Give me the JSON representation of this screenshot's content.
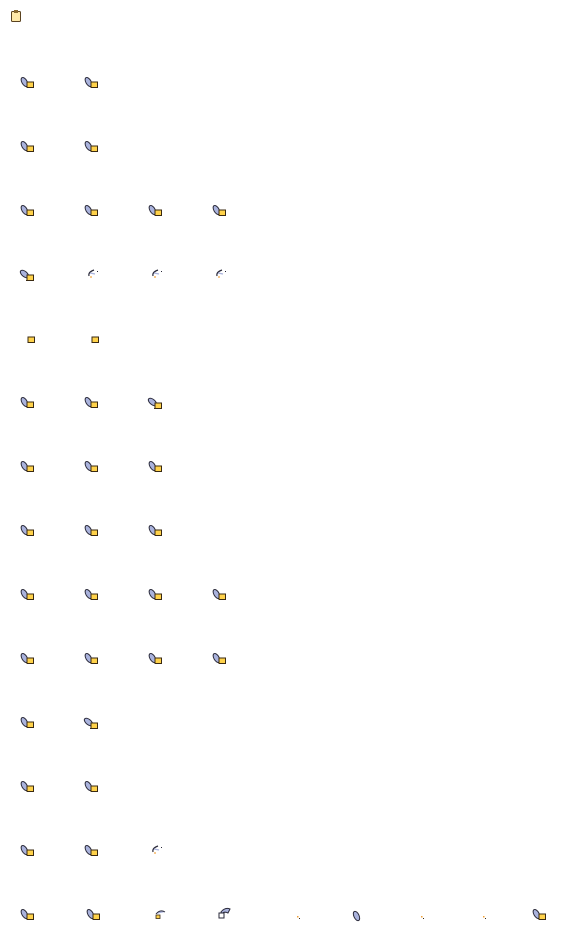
{
  "sprite_sheet": {
    "header_icon": "clipboard-icon",
    "colors": {
      "hand": "#aab3dd",
      "hand_outline": "#2a2a3a",
      "box": "#ffd24a",
      "box_outline": "#3a2a12",
      "spark": "#f2a23a"
    },
    "rows": [
      {
        "frames": [
          "hand-box",
          "hand-box"
        ]
      },
      {
        "frames": [
          "hand-box",
          "hand-box"
        ]
      },
      {
        "frames": [
          "hand-box",
          "hand-box",
          "hand-box",
          "hand-box"
        ]
      },
      {
        "frames": [
          "hand-box-flat",
          "hook",
          "hook",
          "hook"
        ]
      },
      {
        "frames": [
          "box-only",
          "box-only"
        ]
      },
      {
        "frames": [
          "hand-box",
          "hand-box",
          "hand-box-flat"
        ]
      },
      {
        "frames": [
          "hand-box",
          "hand-box",
          "hand-box"
        ]
      },
      {
        "frames": [
          "hand-box",
          "hand-box",
          "hand-box"
        ]
      },
      {
        "frames": [
          "hand-box",
          "hand-box",
          "hand-box",
          "hand-box"
        ]
      },
      {
        "frames": [
          "hand-box",
          "hand-box",
          "hand-box",
          "hand-box"
        ]
      },
      {
        "frames": [
          "hand-box",
          "hand-box-flat"
        ]
      },
      {
        "frames": [
          "hand-box",
          "hand-box"
        ]
      },
      {
        "frames": [
          "hand-box",
          "hand-box",
          "hook"
        ]
      },
      {
        "frames": [
          "hand-box",
          "hand-box",
          "swing-small",
          "swing-large",
          "speck",
          "hand-only",
          "speck",
          "speck",
          "hand-box"
        ]
      }
    ]
  }
}
